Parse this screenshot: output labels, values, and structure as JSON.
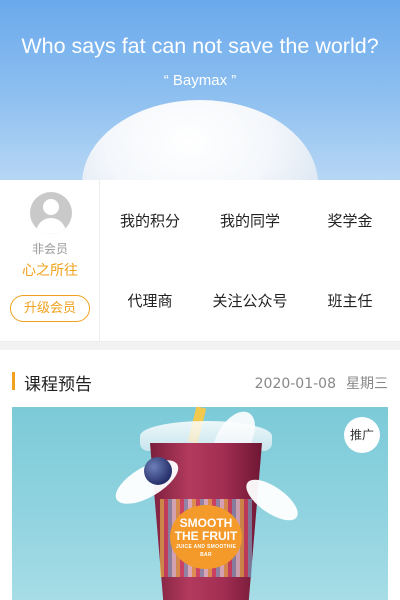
{
  "hero": {
    "title": "Who says fat can not save the world?",
    "subtitle": "“ Baymax ”"
  },
  "member": {
    "level": "非会员",
    "name": "心之所往",
    "upgrade_label": "升级会员"
  },
  "menu": {
    "items": [
      {
        "label": "我的积分"
      },
      {
        "label": "我的同学"
      },
      {
        "label": "奖学金"
      },
      {
        "label": "代理商"
      },
      {
        "label": "关注公众号"
      },
      {
        "label": "班主任"
      }
    ]
  },
  "course": {
    "title": "课程预告",
    "date": "2020-01-08",
    "weekday": "星期三",
    "promo_badge": "推广",
    "brand": {
      "line1": "SMOOTH",
      "line2": "THE FRUIT",
      "tagline": "JUICE AND SMOOTHIE BAR"
    }
  },
  "colors": {
    "accent": "#f0a21e",
    "hero_sky": "#8fc0f0"
  }
}
